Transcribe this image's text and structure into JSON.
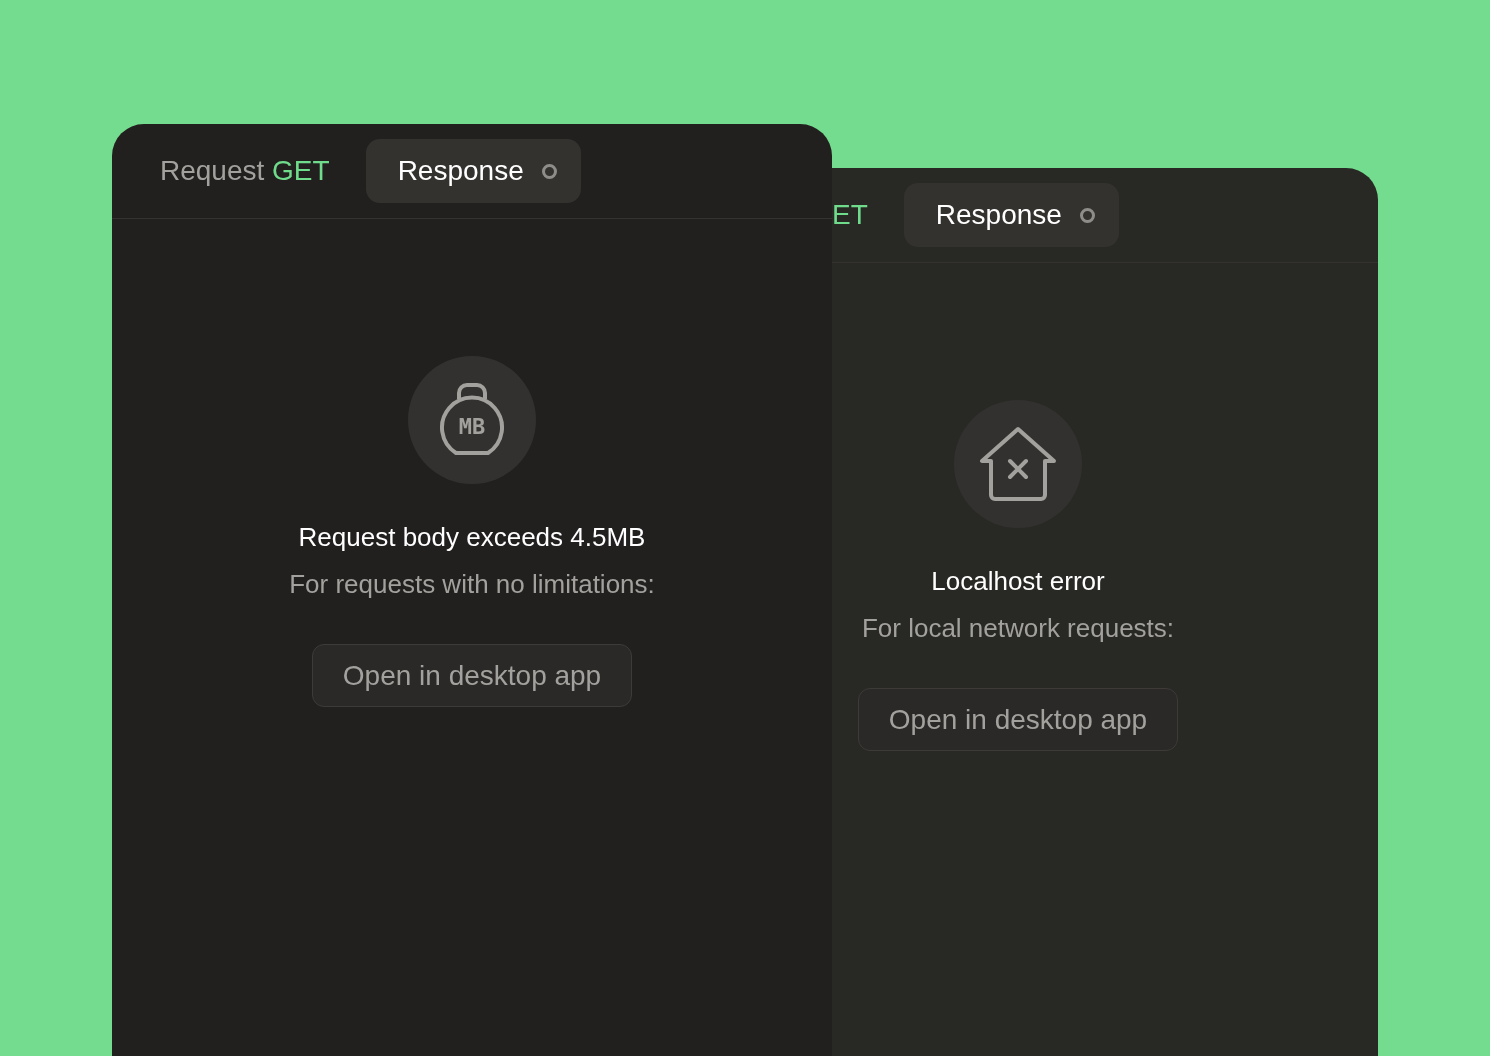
{
  "panels": [
    {
      "tabs": [
        {
          "kind": "request",
          "label": "Request",
          "method": "GET",
          "selected": false
        },
        {
          "kind": "response",
          "label": "Response",
          "selected": true
        }
      ],
      "icon": {
        "kind": "weight",
        "text": "MB"
      },
      "title": "Request body exceeds 4.5MB",
      "subtitle": "For requests with no limitations:",
      "button": "Open in desktop app"
    },
    {
      "tabs": [
        {
          "kind": "request",
          "method": "ET",
          "selected": false
        },
        {
          "kind": "response",
          "label": "Response",
          "selected": true
        }
      ],
      "icon": {
        "kind": "house"
      },
      "title": "Localhost error",
      "subtitle": "For local network requests:",
      "button": "Open in desktop app"
    }
  ]
}
